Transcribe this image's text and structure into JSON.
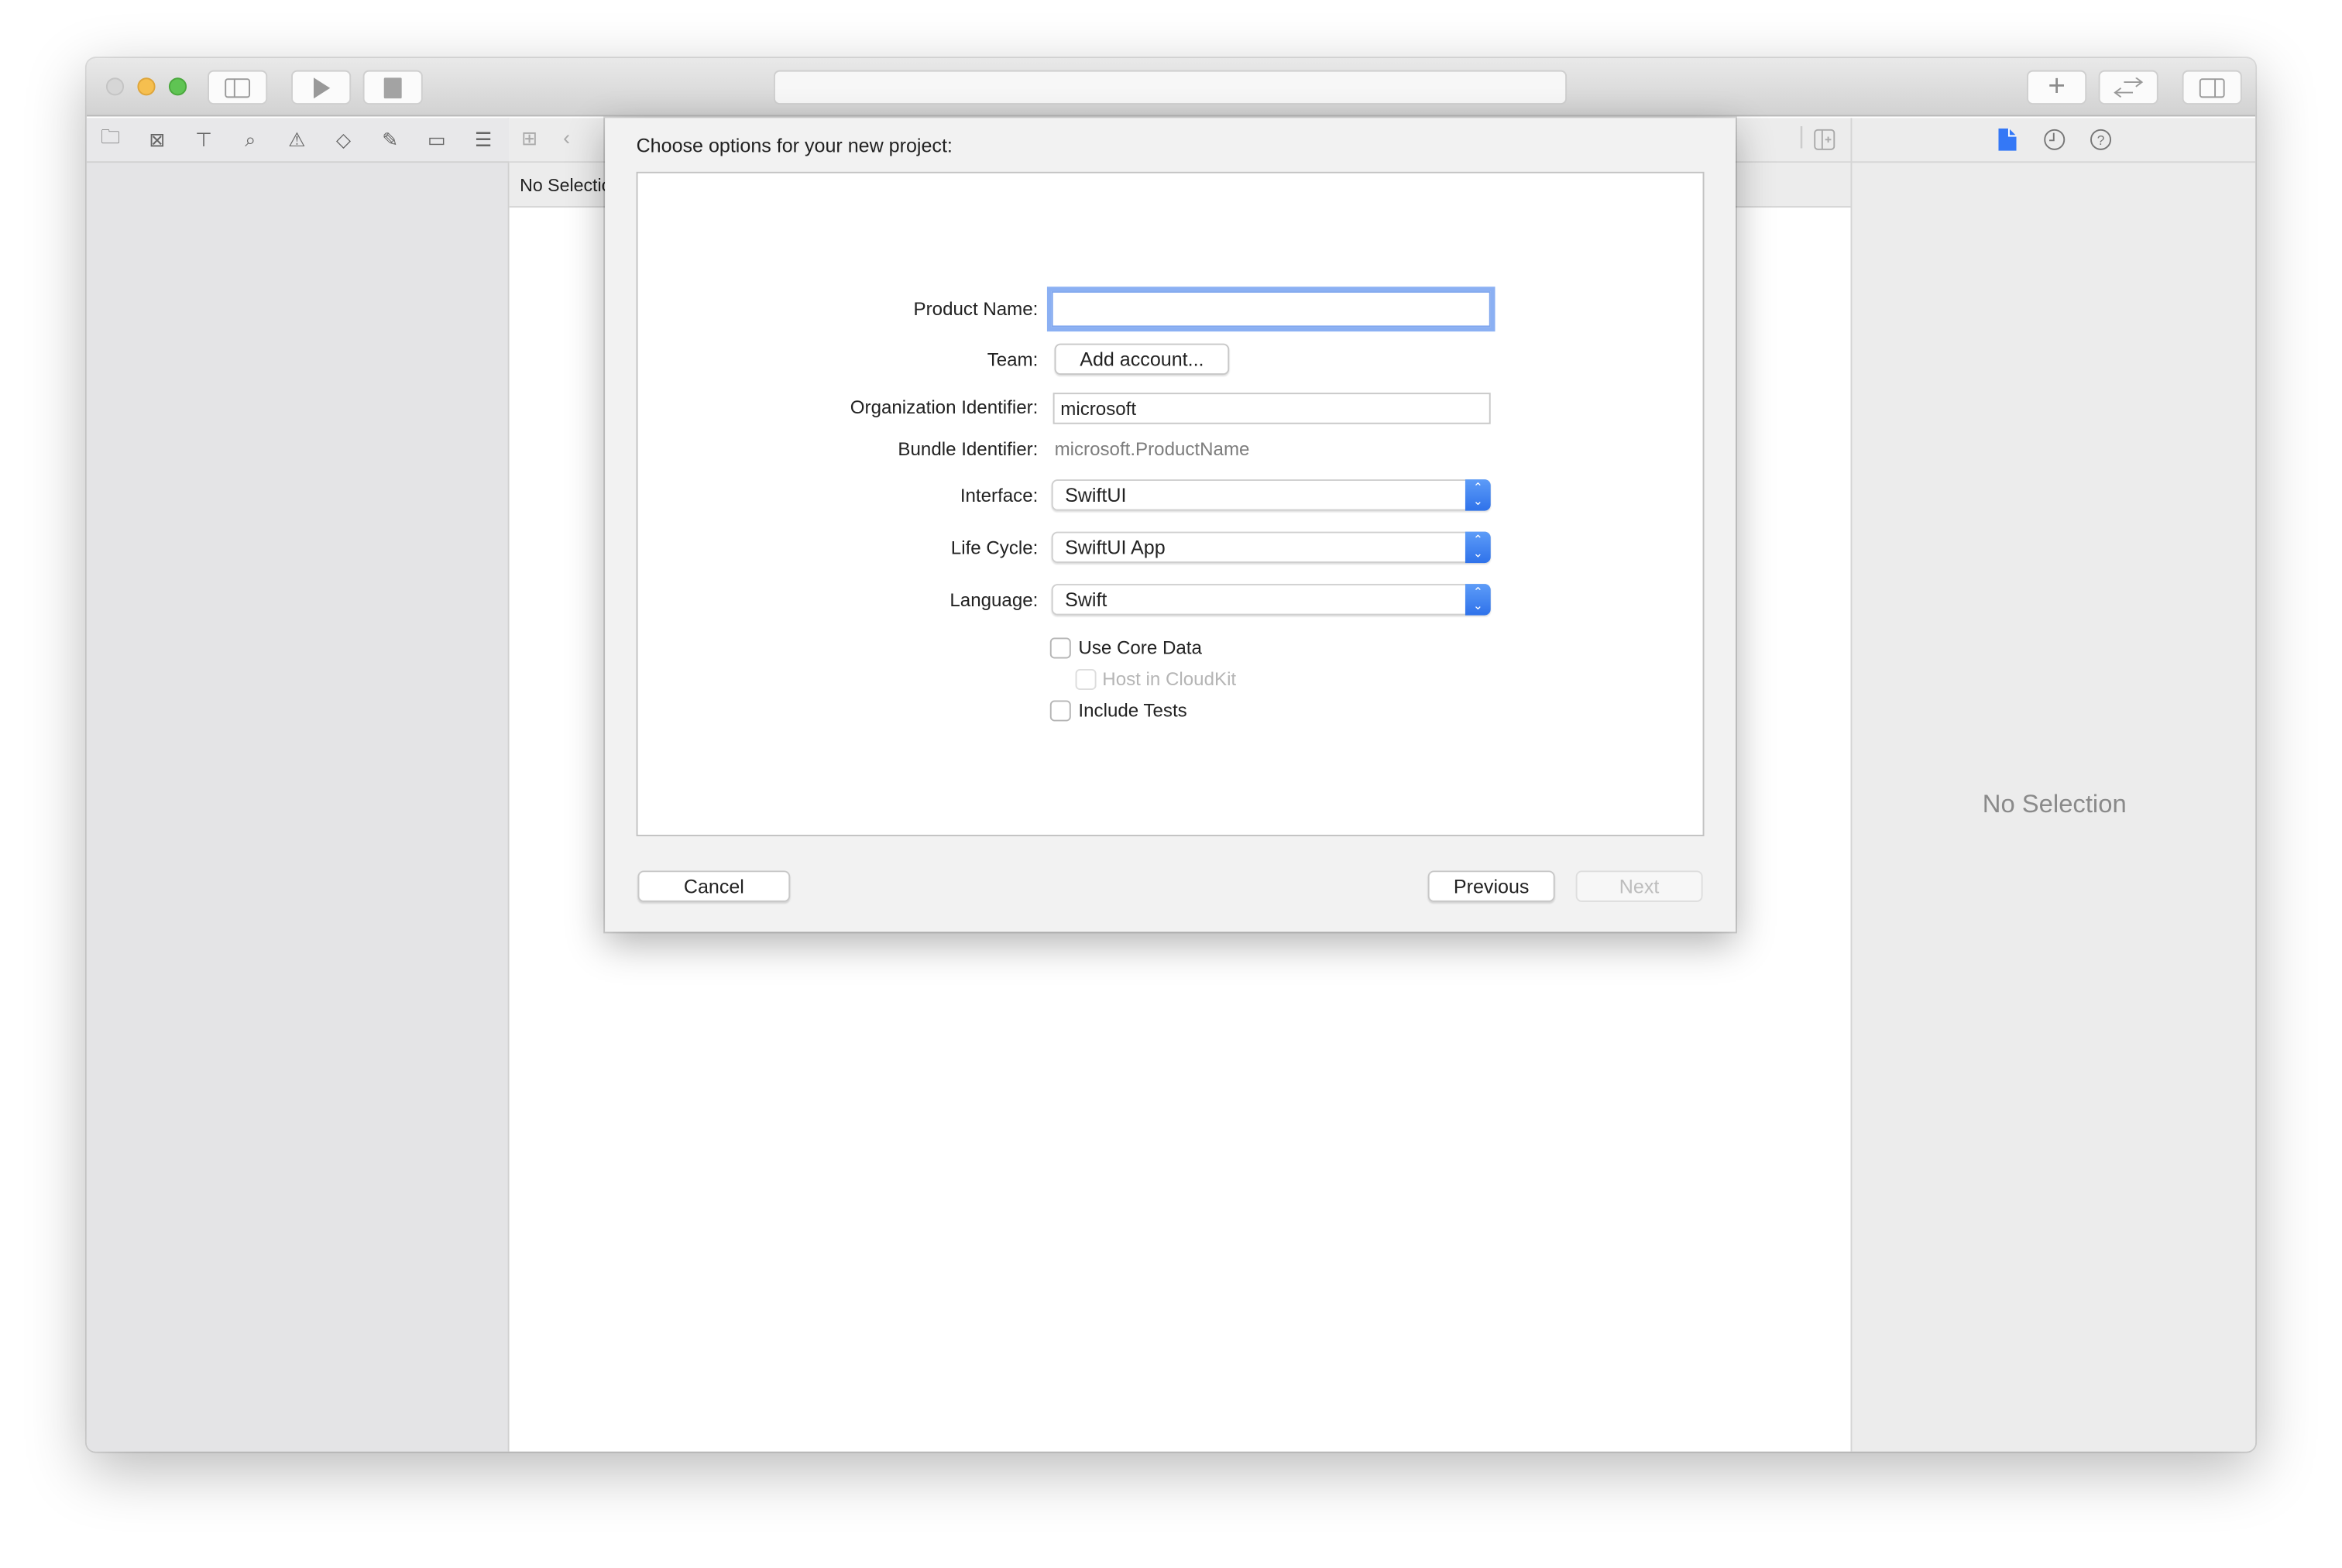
{
  "toolbar": {
    "address": ""
  },
  "navigator": {
    "icons": [
      "folder-icon",
      "source-control-icon",
      "hierarchy-icon",
      "search-icon",
      "warning-icon",
      "test-icon",
      "debug-icon",
      "breakpoint-icon",
      "report-icon"
    ]
  },
  "editor": {
    "path_label": "No Selection"
  },
  "inspector": {
    "no_selection": "No Selection",
    "accent": "#3478f6"
  },
  "dialog": {
    "title": "Choose options for your new project:",
    "product_name": {
      "label": "Product Name:",
      "value": ""
    },
    "team": {
      "label": "Team:",
      "button": "Add account..."
    },
    "org_id": {
      "label": "Organization Identifier:",
      "value": "microsoft"
    },
    "bundle_id": {
      "label": "Bundle Identifier:",
      "value": "microsoft.ProductName"
    },
    "interface": {
      "label": "Interface:",
      "value": "SwiftUI"
    },
    "life_cycle": {
      "label": "Life Cycle:",
      "value": "SwiftUI App"
    },
    "language": {
      "label": "Language:",
      "value": "Swift"
    },
    "use_core_data": {
      "label": "Use Core Data",
      "checked": false
    },
    "host_cloudkit": {
      "label": "Host in CloudKit",
      "checked": false,
      "disabled": true
    },
    "include_tests": {
      "label": "Include Tests",
      "checked": false
    },
    "cancel": "Cancel",
    "previous": "Previous",
    "next": "Next"
  }
}
